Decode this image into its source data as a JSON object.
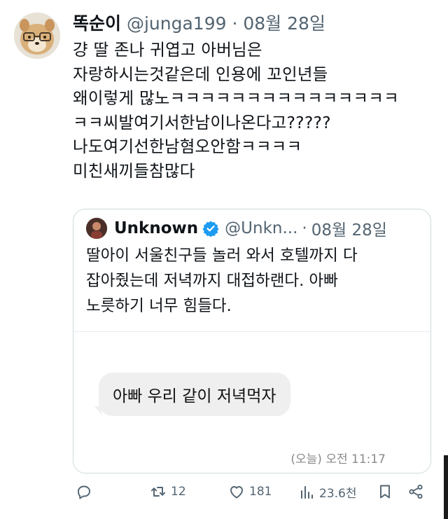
{
  "tweet": {
    "author": {
      "name": "똑순이",
      "handle": "@junga199",
      "separator": "·",
      "date": "08월 28일",
      "avatar": "dog-avatar"
    },
    "lines": [
      "걍 딸 존나 귀엽고 아버님은",
      "자랑하시는것같은데 인용에 꼬인년들",
      "왜이렇게 많노ㅋㅋㅋㅋㅋㅋㅋㅋㅋㅋㅋㅋㅋㅋㅋ",
      "ㅋㅋ씨발여기서한남이나온다고?????",
      "나도여기선한남혐오안함ㅋㅋㅋㅋ",
      "미친새끼들참많다"
    ],
    "quote": {
      "name": "Unknown",
      "handle": "@Unkn...",
      "separator": "·",
      "date": "08월 28일",
      "verified": true,
      "lines": [
        "딸아이 서울친구들 놀러 와서 호텔까지 다",
        "잡아줬는데 저녁까지 대접하랜다. 아빠",
        "노릇하기 너무 힘들다."
      ],
      "media": {
        "message": "아빠 우리 같이 저녁먹자",
        "timestamp": "(오늘) 오전 11:17"
      }
    },
    "actions": {
      "reply": {
        "icon": "reply-icon",
        "count": ""
      },
      "retweet": {
        "icon": "retweet-icon",
        "count": "12"
      },
      "like": {
        "icon": "heart-icon",
        "count": "181"
      },
      "views": {
        "icon": "views-icon",
        "count": "23.6천"
      },
      "bookmark": {
        "icon": "bookmark-icon"
      },
      "share": {
        "icon": "share-icon"
      }
    },
    "colors": {
      "text": "#0f1419",
      "muted": "#536471",
      "verified": "#1d9bf0",
      "border": "#cfd9de"
    }
  }
}
